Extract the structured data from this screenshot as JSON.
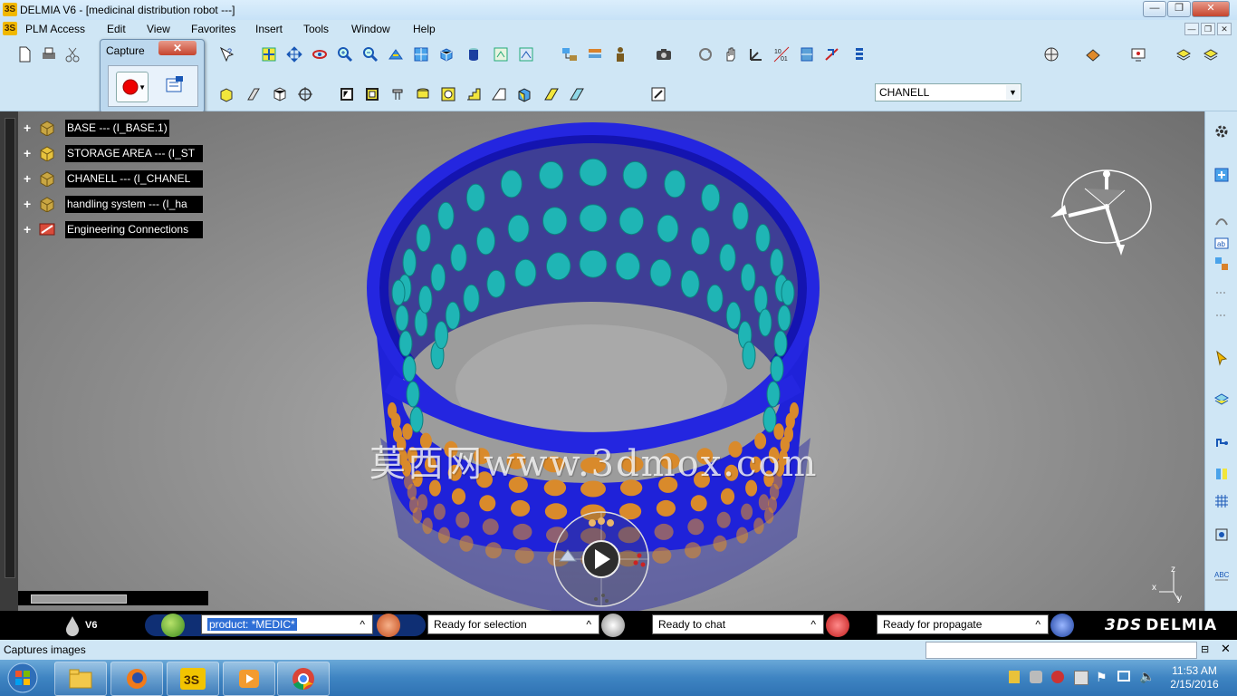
{
  "window": {
    "title": "DELMIA V6 - [medicinal distribution robot ---]",
    "logo_text": "3S",
    "minimize": "—",
    "restore": "❐",
    "close": "✕",
    "doc_minimize": "—",
    "doc_restore": "❐",
    "doc_close": "✕"
  },
  "menu": {
    "items": [
      {
        "label": "PLM Access",
        "key": "P"
      },
      {
        "label": "Edit",
        "key": "E"
      },
      {
        "label": "View",
        "key": "V"
      },
      {
        "label": "Favorites",
        "key": "a"
      },
      {
        "label": "Insert",
        "key": "I"
      },
      {
        "label": "Tools",
        "key": "T"
      },
      {
        "label": "Window",
        "key": "W"
      },
      {
        "label": "Help",
        "key": "H"
      }
    ]
  },
  "toolbar": {
    "context_combo_value": "CHANELL"
  },
  "capture_window": {
    "title": "Capture",
    "close": "✕"
  },
  "tree": {
    "nodes": [
      {
        "label": "BASE --- (I_BASE.1)"
      },
      {
        "label": "STORAGE AREA --- (I_ST"
      },
      {
        "label": "CHANELL --- (I_CHANEL"
      },
      {
        "label": "handling system --- (I_ha"
      },
      {
        "label": "Engineering Connections"
      }
    ]
  },
  "viewport": {
    "watermark": "莫西网www.3dmox.com",
    "axis_labels": {
      "x": "x",
      "y": "y",
      "z": "z"
    },
    "colors": {
      "ring": "#1f22d9",
      "cells_inner": "#1fb5b5",
      "cells_outer": "#d98a2b"
    }
  },
  "statusbar": {
    "v6_label": "V6",
    "command_value": "product: *MEDIC*",
    "fields": [
      {
        "label": "Ready for selection"
      },
      {
        "label": "Ready to chat"
      },
      {
        "label": "Ready for propagate"
      }
    ],
    "brand": "DELMIA",
    "brand_prefix": "3DS"
  },
  "capture_line": {
    "text": "Captures images"
  },
  "taskbar": {
    "time": "11:53 AM",
    "date": "2/15/2016"
  }
}
